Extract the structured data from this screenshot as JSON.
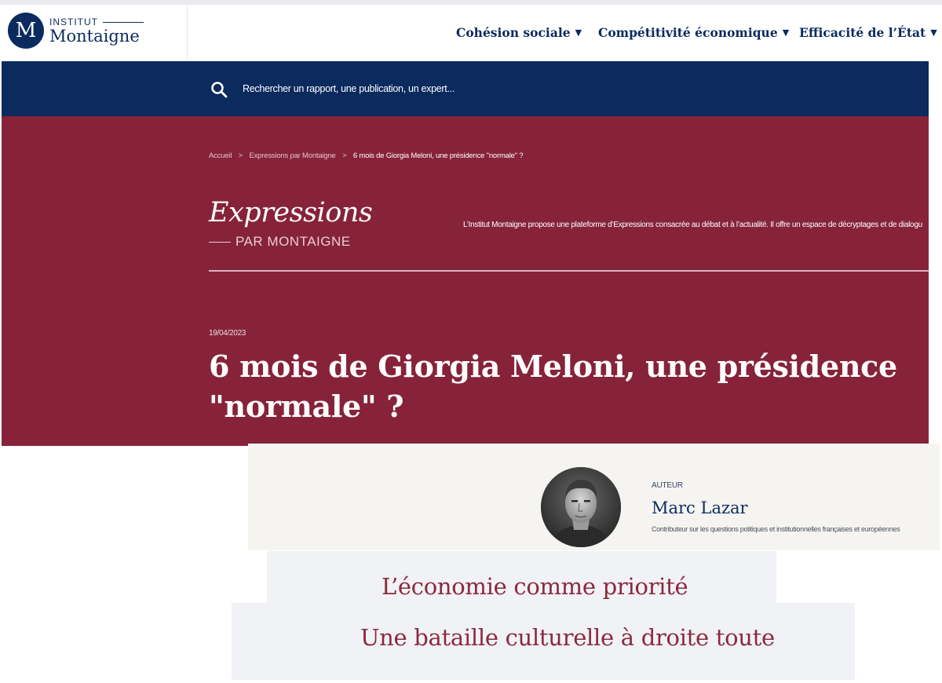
{
  "header": {
    "logo": {
      "mark": "M",
      "institut": "INSTITUT",
      "name": "Montaigne"
    },
    "nav": [
      {
        "label": "Cohésion sociale",
        "caret": "▼"
      },
      {
        "label": "Compétitivité économique",
        "caret": "▼"
      },
      {
        "label": "Efficacité de l’État",
        "caret": "▼"
      }
    ]
  },
  "search": {
    "placeholder": "Rechercher un rapport, une publication, un expert..."
  },
  "breadcrumb": {
    "items": [
      "Accueil",
      "Expressions par Montaigne",
      "6 mois de Giorgia Meloni, une présidence \"normale\" ?"
    ],
    "separator": ">"
  },
  "section": {
    "title": "Expressions",
    "subtitle": "PAR MONTAIGNE",
    "description": "L’Institut Montaigne propose une plateforme d’Expressions consacrée au débat et à l’actualité. Il offre un espace de décryptages et de dialogu"
  },
  "article": {
    "date": "19/04/2023",
    "title": "6 mois de Giorgia Meloni, une présidence \"normale\" ?"
  },
  "author": {
    "label": "AUTEUR",
    "name": "Marc Lazar",
    "role": "Contributeur sur les questions politiques et institutionnelles françaises et européennes"
  },
  "headings": [
    "L’économie comme priorité",
    "Une bataille culturelle à droite toute"
  ],
  "colors": {
    "navy": "#0b2a5e",
    "burgundy": "#862339",
    "heading_red": "#8a2a40",
    "author_bg": "#f5f4f1"
  }
}
